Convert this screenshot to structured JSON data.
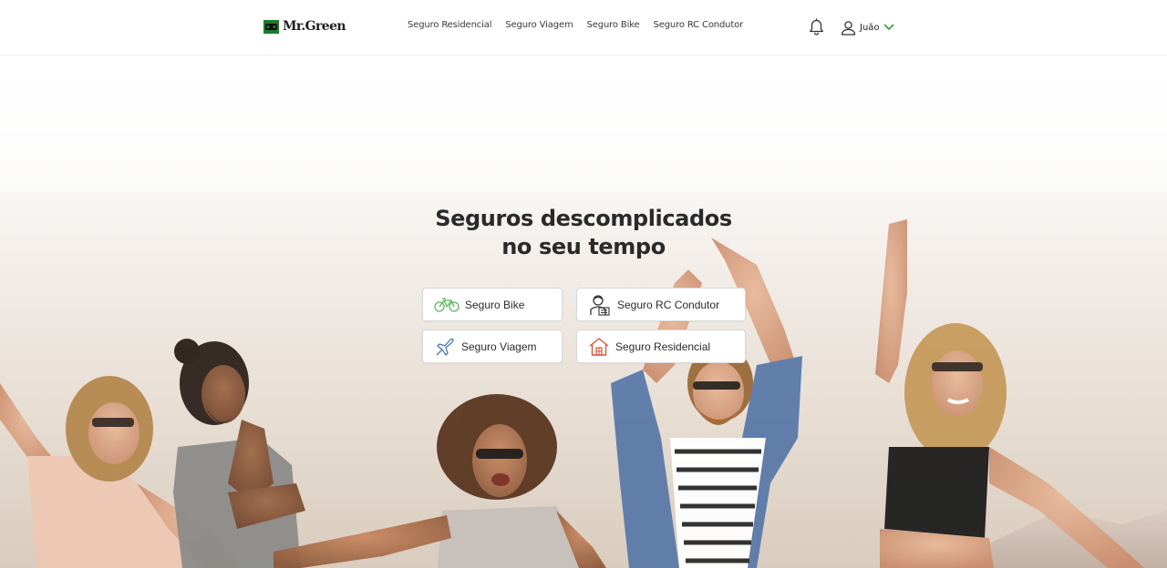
{
  "header": {
    "logo_text": "Mr.Green",
    "nav": [
      {
        "label": "Seguro Residencial"
      },
      {
        "label": "Seguro Viagem"
      },
      {
        "label": "Seguro Bike"
      },
      {
        "label": "Seguro RC Condutor"
      }
    ],
    "user_name": "Juão"
  },
  "hero": {
    "title_line1": "Seguros descomplicados",
    "title_line2": "no seu tempo"
  },
  "products": [
    {
      "label": "Seguro Bike",
      "icon": "bicycle-icon"
    },
    {
      "label": "Seguro RC Condutor",
      "icon": "driver-icon"
    },
    {
      "label": "Seguro Viagem",
      "icon": "airplane-icon"
    },
    {
      "label": "Seguro Residencial",
      "icon": "house-icon"
    }
  ],
  "colors": {
    "brand_green": "#3b9a3b",
    "text_dark": "#2a2a2a",
    "button_border": "#d8d8d8"
  }
}
